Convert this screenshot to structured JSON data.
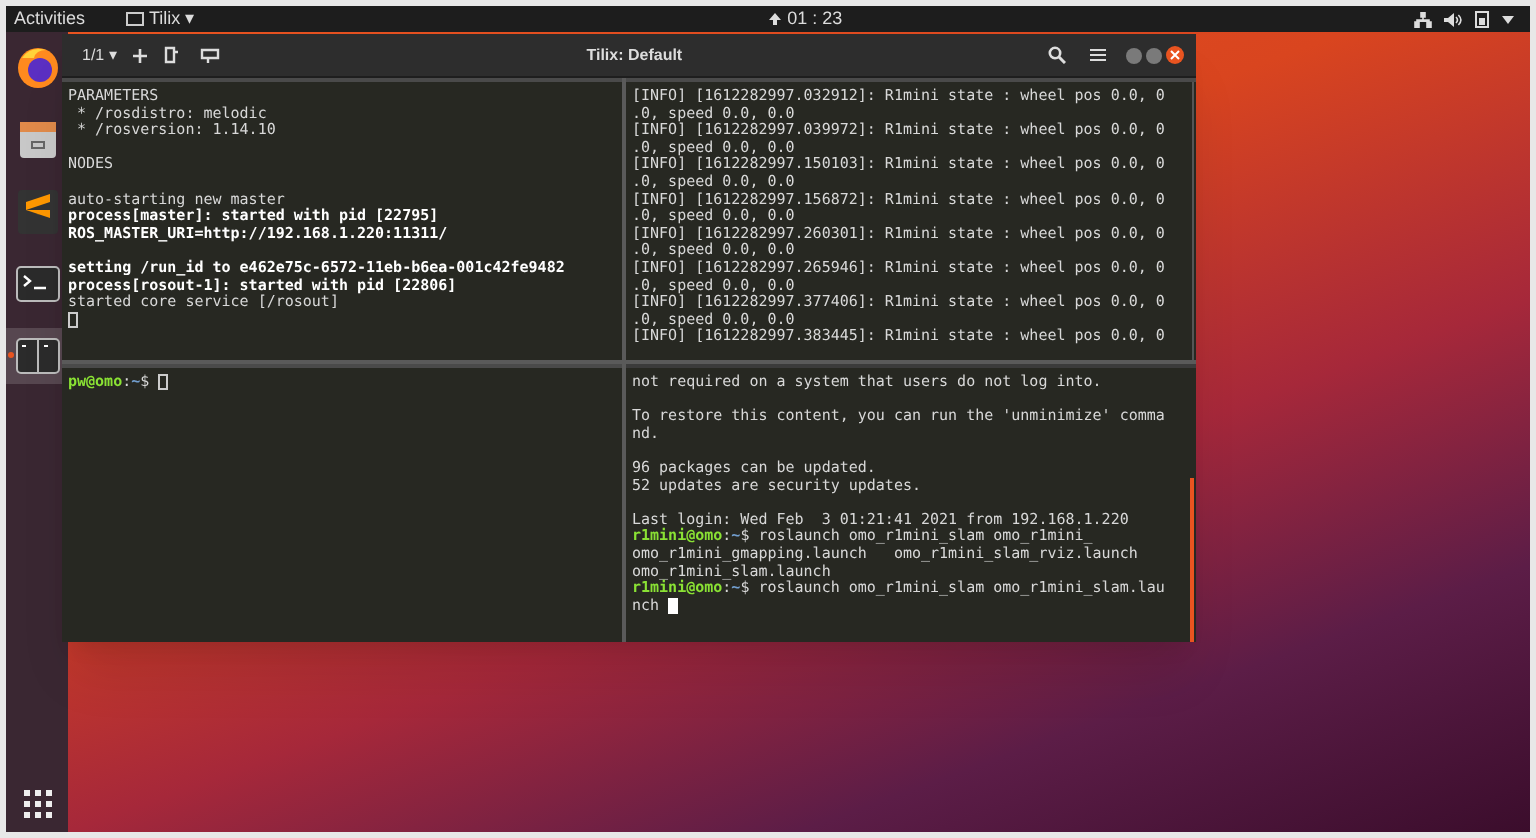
{
  "top_bar": {
    "activities": "Activities",
    "app_menu": "Tilix ▾",
    "clock": "01 : 23"
  },
  "dock": {
    "items": [
      {
        "kind": "firefox",
        "selected": false
      },
      {
        "kind": "files",
        "selected": false
      },
      {
        "kind": "sublime",
        "selected": false
      },
      {
        "kind": "terminal",
        "selected": false
      },
      {
        "kind": "tilix",
        "selected": true
      }
    ]
  },
  "window": {
    "title": "Tilix: Default",
    "session": "1/1 ▾",
    "panes": [
      {
        "focused": false,
        "lines": [
          {
            "kind": "text",
            "segments": [
              {
                "kind": "plain",
                "text": "PARAMETERS"
              }
            ]
          },
          {
            "kind": "text",
            "segments": [
              {
                "kind": "plain",
                "text": " * /rosdistro: melodic"
              }
            ]
          },
          {
            "kind": "text",
            "segments": [
              {
                "kind": "plain",
                "text": " * /rosversion: 1.14.10"
              }
            ]
          },
          {
            "kind": "blank"
          },
          {
            "kind": "text",
            "segments": [
              {
                "kind": "plain",
                "text": "NODES"
              }
            ]
          },
          {
            "kind": "blank"
          },
          {
            "kind": "text",
            "segments": [
              {
                "kind": "plain",
                "text": "auto-starting new master"
              }
            ]
          },
          {
            "kind": "text",
            "segments": [
              {
                "kind": "bold",
                "text": "process[master]: started with pid [22795]"
              }
            ]
          },
          {
            "kind": "text",
            "segments": [
              {
                "kind": "bold",
                "text": "ROS_MASTER_URI=http://192.168.1.220:11311/"
              }
            ]
          },
          {
            "kind": "blank"
          },
          {
            "kind": "text",
            "segments": [
              {
                "kind": "bold",
                "text": "setting /run_id to e462e75c-6572-11eb-b6ea-001c42fe9482"
              }
            ]
          },
          {
            "kind": "text",
            "segments": [
              {
                "kind": "bold",
                "text": "process[rosout-1]: started with pid [22806]"
              }
            ]
          },
          {
            "kind": "text",
            "segments": [
              {
                "kind": "plain",
                "text": "started core service [/rosout]"
              }
            ]
          },
          {
            "kind": "cursor"
          }
        ]
      },
      {
        "focused": false,
        "lines": [
          {
            "kind": "text",
            "segments": [
              {
                "kind": "plain",
                "text": "[INFO] [1612282997.032912]: R1mini state : wheel pos 0.0, 0"
              }
            ]
          },
          {
            "kind": "text",
            "segments": [
              {
                "kind": "plain",
                "text": ".0, speed 0.0, 0.0"
              }
            ]
          },
          {
            "kind": "text",
            "segments": [
              {
                "kind": "plain",
                "text": "[INFO] [1612282997.039972]: R1mini state : wheel pos 0.0, 0"
              }
            ]
          },
          {
            "kind": "text",
            "segments": [
              {
                "kind": "plain",
                "text": ".0, speed 0.0, 0.0"
              }
            ]
          },
          {
            "kind": "text",
            "segments": [
              {
                "kind": "plain",
                "text": "[INFO] [1612282997.150103]: R1mini state : wheel pos 0.0, 0"
              }
            ]
          },
          {
            "kind": "text",
            "segments": [
              {
                "kind": "plain",
                "text": ".0, speed 0.0, 0.0"
              }
            ]
          },
          {
            "kind": "text",
            "segments": [
              {
                "kind": "plain",
                "text": "[INFO] [1612282997.156872]: R1mini state : wheel pos 0.0, 0"
              }
            ]
          },
          {
            "kind": "text",
            "segments": [
              {
                "kind": "plain",
                "text": ".0, speed 0.0, 0.0"
              }
            ]
          },
          {
            "kind": "text",
            "segments": [
              {
                "kind": "plain",
                "text": "[INFO] [1612282997.260301]: R1mini state : wheel pos 0.0, 0"
              }
            ]
          },
          {
            "kind": "text",
            "segments": [
              {
                "kind": "plain",
                "text": ".0, speed 0.0, 0.0"
              }
            ]
          },
          {
            "kind": "text",
            "segments": [
              {
                "kind": "plain",
                "text": "[INFO] [1612282997.265946]: R1mini state : wheel pos 0.0, 0"
              }
            ]
          },
          {
            "kind": "text",
            "segments": [
              {
                "kind": "plain",
                "text": ".0, speed 0.0, 0.0"
              }
            ]
          },
          {
            "kind": "text",
            "segments": [
              {
                "kind": "plain",
                "text": "[INFO] [1612282997.377406]: R1mini state : wheel pos 0.0, 0"
              }
            ]
          },
          {
            "kind": "text",
            "segments": [
              {
                "kind": "plain",
                "text": ".0, speed 0.0, 0.0"
              }
            ]
          },
          {
            "kind": "text",
            "segments": [
              {
                "kind": "plain",
                "text": "[INFO] [1612282997.383445]: R1mini state : wheel pos 0.0, 0"
              }
            ]
          }
        ]
      },
      {
        "focused": false,
        "lines": [
          {
            "kind": "text",
            "segments": [
              {
                "kind": "user",
                "text": "pw@omo"
              },
              {
                "kind": "plain",
                "text": ":"
              },
              {
                "kind": "path",
                "text": "~"
              },
              {
                "kind": "plain",
                "text": "$ "
              }
            ],
            "cursor": true
          }
        ]
      },
      {
        "focused": true,
        "lines": [
          {
            "kind": "text",
            "segments": [
              {
                "kind": "plain",
                "text": "not required on a system that users do not log into."
              }
            ]
          },
          {
            "kind": "blank"
          },
          {
            "kind": "text",
            "segments": [
              {
                "kind": "plain",
                "text": "To restore this content, you can run the 'unminimize' comma"
              }
            ]
          },
          {
            "kind": "text",
            "segments": [
              {
                "kind": "plain",
                "text": "nd."
              }
            ]
          },
          {
            "kind": "blank"
          },
          {
            "kind": "text",
            "segments": [
              {
                "kind": "plain",
                "text": "96 packages can be updated."
              }
            ]
          },
          {
            "kind": "text",
            "segments": [
              {
                "kind": "plain",
                "text": "52 updates are security updates."
              }
            ]
          },
          {
            "kind": "blank"
          },
          {
            "kind": "text",
            "segments": [
              {
                "kind": "plain",
                "text": "Last login: Wed Feb  3 01:21:41 2021 from 192.168.1.220"
              }
            ]
          },
          {
            "kind": "text",
            "segments": [
              {
                "kind": "user",
                "text": "r1mini@omo"
              },
              {
                "kind": "plain",
                "text": ":"
              },
              {
                "kind": "path",
                "text": "~"
              },
              {
                "kind": "plain",
                "text": "$ roslaunch omo_r1mini_slam omo_r1mini_"
              }
            ]
          },
          {
            "kind": "text",
            "segments": [
              {
                "kind": "plain",
                "text": "omo_r1mini_gmapping.launch   omo_r1mini_slam_rviz.launch"
              }
            ]
          },
          {
            "kind": "text",
            "segments": [
              {
                "kind": "plain",
                "text": "omo_r1mini_slam.launch"
              }
            ]
          },
          {
            "kind": "text",
            "segments": [
              {
                "kind": "user",
                "text": "r1mini@omo"
              },
              {
                "kind": "plain",
                "text": ":"
              },
              {
                "kind": "path",
                "text": "~"
              },
              {
                "kind": "plain",
                "text": "$ roslaunch omo_r1mini_slam omo_r1mini_slam.lau"
              }
            ]
          },
          {
            "kind": "text",
            "segments": [
              {
                "kind": "plain",
                "text": "nch "
              }
            ],
            "cursor": true
          }
        ]
      }
    ]
  }
}
